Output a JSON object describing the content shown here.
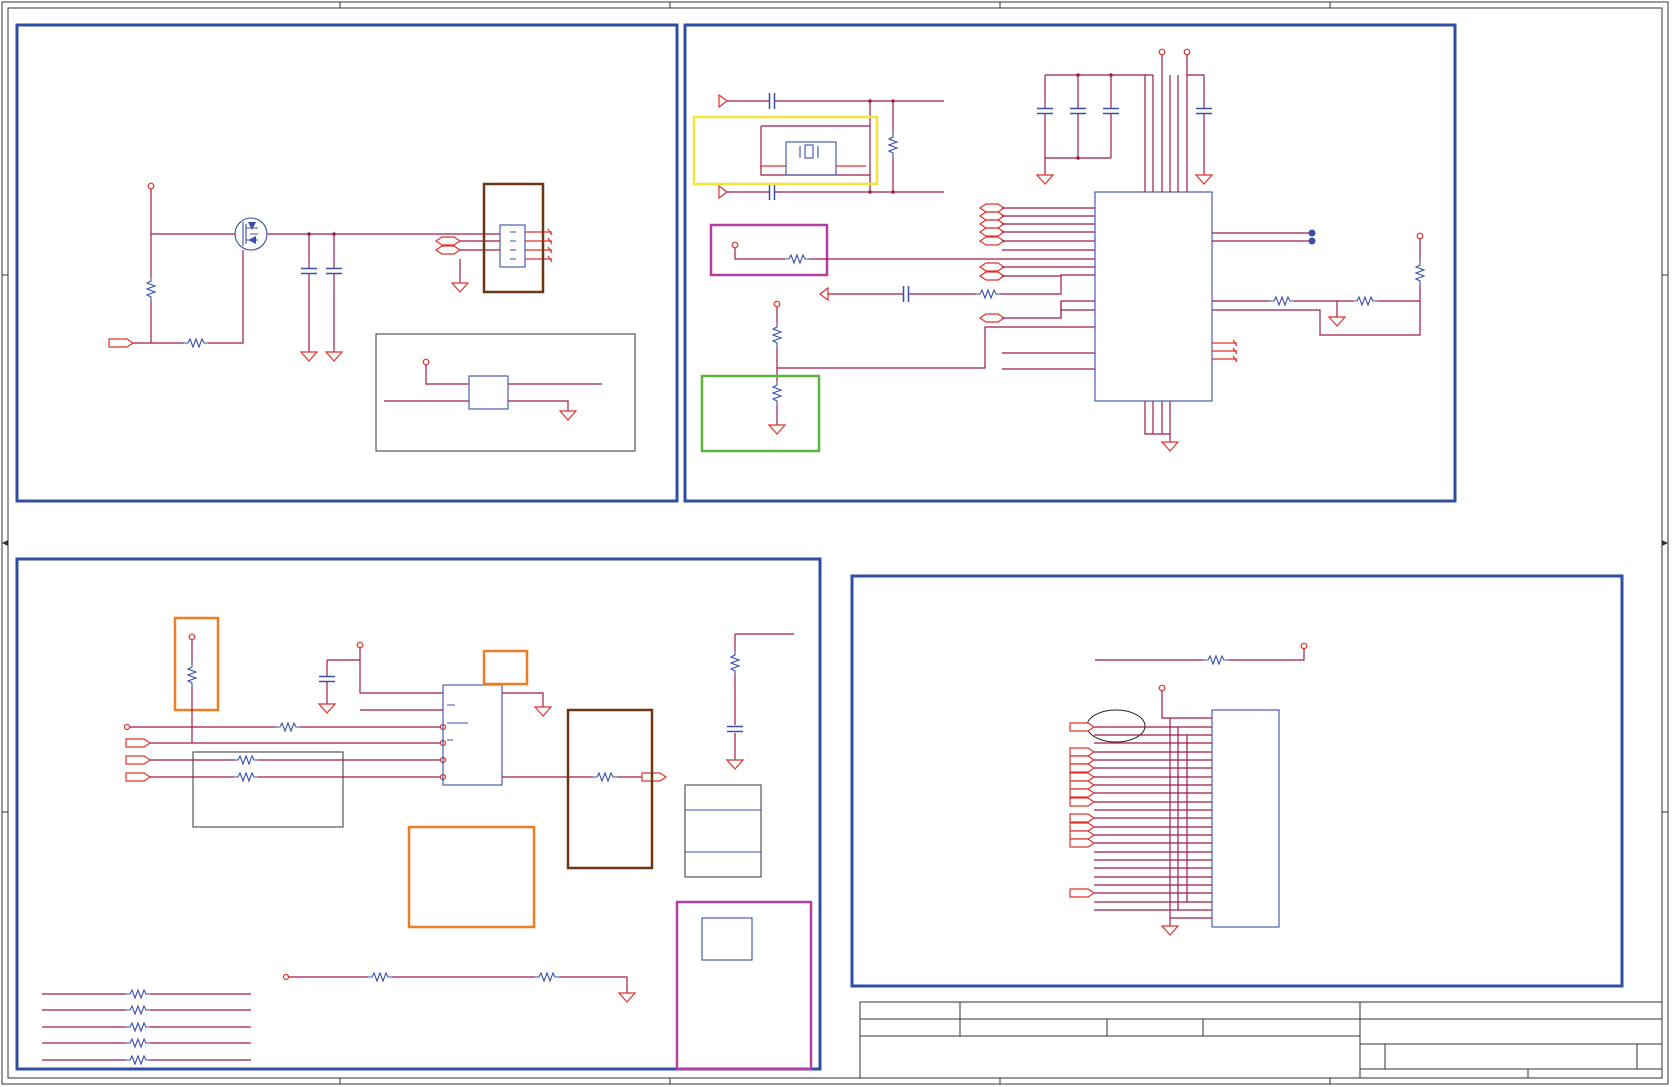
{
  "colors": {
    "wire": "#9e1b4d",
    "net_symbol": "#e0322c",
    "component": "#3a4fa8",
    "block_border": "#2d4ea3",
    "highlight_yellow": "#f2e53a",
    "highlight_magenta": "#b43fa3",
    "highlight_green": "#5db33c",
    "highlight_orange": "#ee7d23",
    "highlight_brown": "#6b3714",
    "frame": "#333333"
  },
  "icons": [
    "ground-icon",
    "power-pin-icon",
    "resistor-icon",
    "capacitor-icon",
    "mosfet-icon",
    "crystal-icon",
    "off-page-connector-icon"
  ]
}
